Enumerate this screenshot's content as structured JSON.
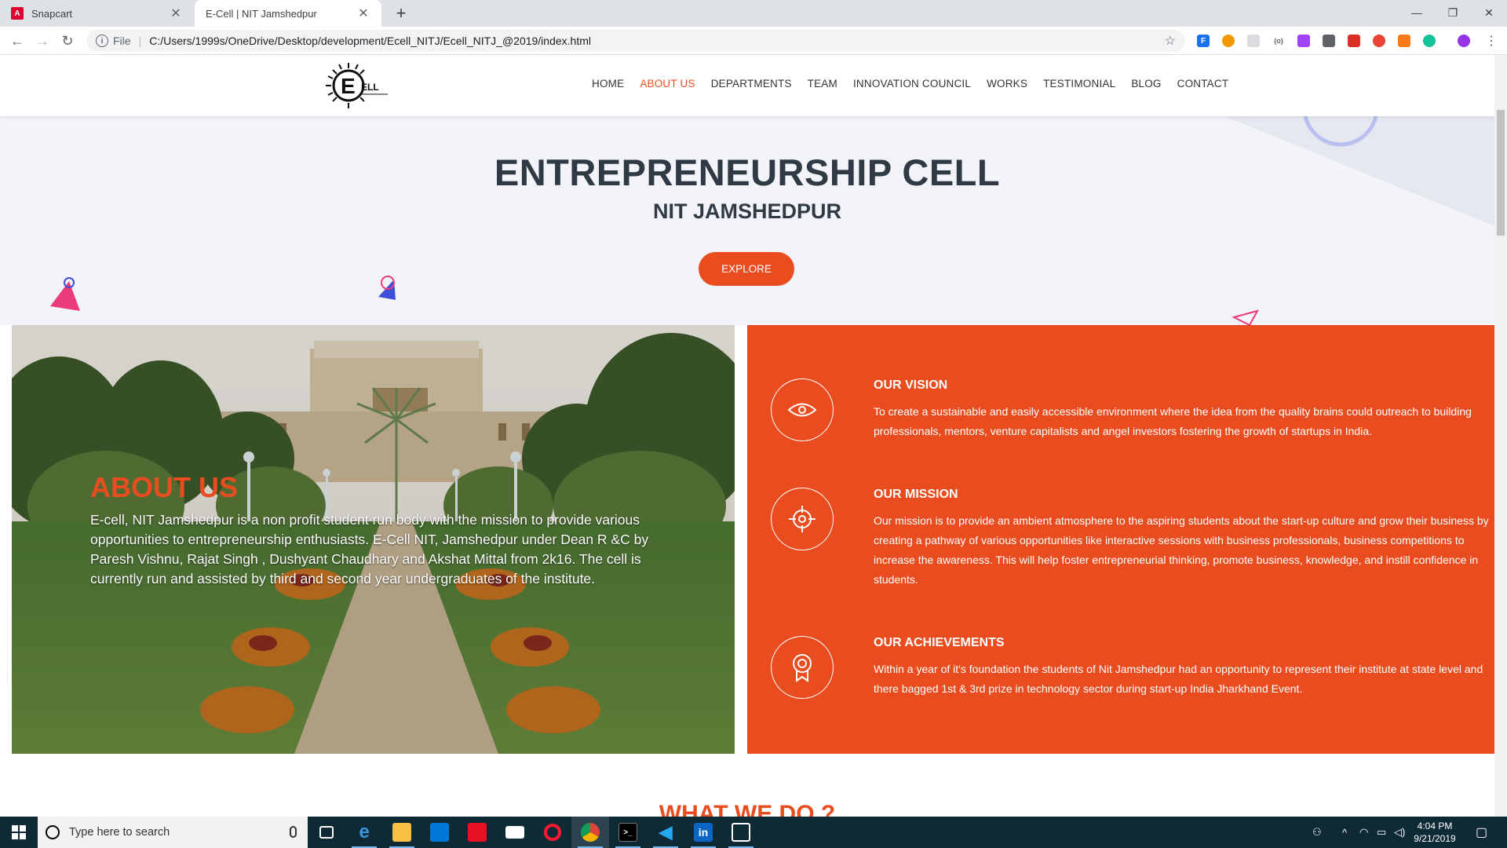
{
  "browser": {
    "tabs": [
      {
        "title": "Snapcart",
        "favicon": "A"
      },
      {
        "title": "E-Cell | NIT Jamshedpur",
        "favicon": "⚙"
      }
    ],
    "address": {
      "scheme": "File",
      "url": "C:/Users/1999s/OneDrive/Desktop/development/Ecell_NITJ/Ecell_NITJ_@2019/index.html"
    }
  },
  "site": {
    "logo_text": "ELL",
    "nav": [
      "HOME",
      "ABOUT US",
      "DEPARTMENTS",
      "TEAM",
      "INNOVATION COUNCIL",
      "WORKS",
      "TESTIMONIAL",
      "BLOG",
      "CONTACT"
    ],
    "active_nav": "ABOUT US",
    "hero": {
      "title": "ENTREPRENEURSHIP CELL",
      "subtitle": "NIT JAMSHEDPUR",
      "cta": "EXPLORE"
    },
    "about": {
      "heading": "ABOUT US",
      "body": "E-cell, NIT Jamshedpur is a non profit student run body with the mission to provide various opportunities to entrepreneurship enthusiasts. E-Cell NIT, Jamshedpur under Dean R &C by Paresh Vishnu, Rajat Singh , Dushyant Chaudhary and Akshat Mittal from 2k16. The cell is currently run and assisted by third and second year undergraduates of the institute."
    },
    "features": [
      {
        "title": "OUR VISION",
        "icon": "eye-icon",
        "text": "To create a sustainable and easily accessible environment where the idea from the quality brains could outreach to building professionals, mentors, venture capitalists and angel investors fostering the growth of startups in India."
      },
      {
        "title": "OUR MISSION",
        "icon": "target-icon",
        "text": "Our mission is to provide an ambient atmosphere to the aspiring students about the start-up culture and grow their business by creating a pathway of various opportunities like interactive sessions with business professionals, business competitions to increase the awareness. This will help foster entrepreneurial thinking, promote business, knowledge, and instill confidence in students."
      },
      {
        "title": "OUR ACHIEVEMENTS",
        "icon": "medal-icon",
        "text": "Within a year of it's foundation the students of Nit Jamshedpur had an opportunity to represent their institute at state level and there bagged 1st & 3rd prize in technology sector during start-up India Jharkhand Event."
      }
    ],
    "next_section": "WHAT WE DO ?",
    "colors": {
      "accent": "#e94d1f",
      "heading": "#2f3a45",
      "hero_bg": "#f3f4f9"
    }
  },
  "taskbar": {
    "search_placeholder": "Type here to search",
    "time": "4:04 PM",
    "date": "9/21/2019"
  }
}
